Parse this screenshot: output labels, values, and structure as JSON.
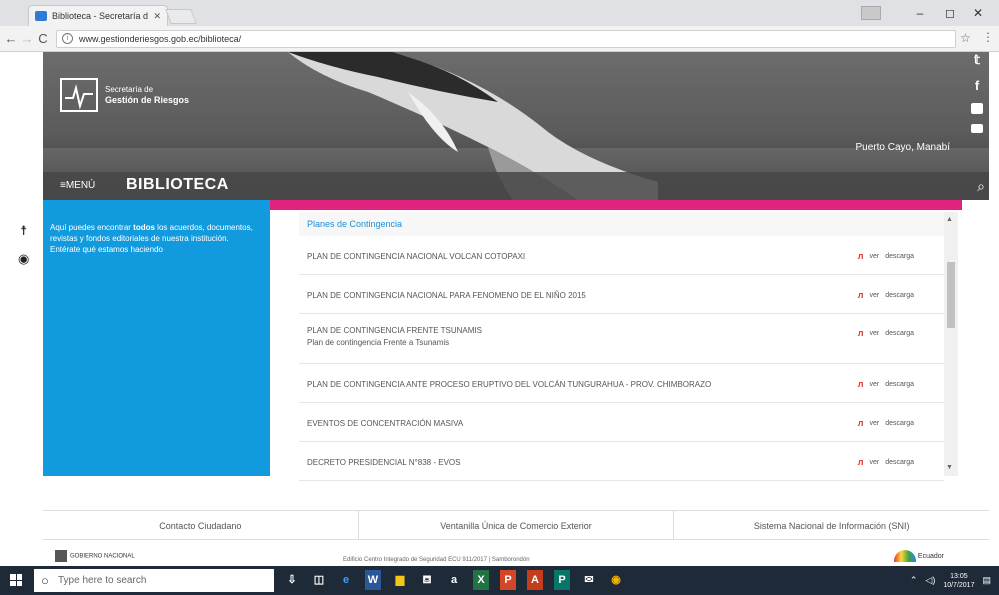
{
  "browser": {
    "tab_title": "Biblioteca - Secretaría de",
    "tab_close": "✕",
    "win_minimize": "–",
    "win_maximize": "◻",
    "win_close": "✕",
    "url": "www.gestionderiesgos.gob.ec/biblioteca/",
    "back": "←",
    "forward": "→",
    "reload": "C",
    "info": "i",
    "star": "☆",
    "menu": "⋮"
  },
  "header": {
    "logo_line1": "Secretaría de",
    "logo_line2": "Gestión de Riesgos",
    "location": "Puerto Cayo, Manabí",
    "menu_toggle": "≡MENÚ",
    "page_title": "BIBLIOTECA",
    "social": {
      "twitter": "𝕥",
      "facebook": "f"
    },
    "search": "⌕"
  },
  "accessibility": {
    "person": "☨",
    "eye": "◉"
  },
  "sidebar": {
    "intro_pre": "Aquí puedes encontrar ",
    "intro_bold": "todos",
    "intro_post": " los acuerdos, documentos, revistas y fondos editoriales de nuestra institución.",
    "cta": "Entérate qué estamos haciendo"
  },
  "documents": {
    "category": "Planes de Contingencia",
    "view_label": "ver",
    "download_label": "descarga",
    "items": [
      {
        "title": "PLAN DE CONTINGENCIA NACIONAL VOLCAN COTOPAXI",
        "subtitle": ""
      },
      {
        "title": "PLAN DE CONTINGENCIA NACIONAL PARA FENOMENO DE EL NIÑO 2015",
        "subtitle": ""
      },
      {
        "title": "PLAN DE CONTINGENCIA FRENTE TSUNAMIS",
        "subtitle": "Plan de contingencia Frente a Tsunamis"
      },
      {
        "title": "PLAN DE CONTINGENCIA ANTE PROCESO ERUPTIVO DEL VOLCÁN TUNGURAHUA - PROV. CHIMBORAZO",
        "subtitle": ""
      },
      {
        "title": "EVENTOS DE CONCENTRACIÓN MASIVA",
        "subtitle": ""
      },
      {
        "title": "DECRETO PRESIDENCIAL N°838 - EVOS",
        "subtitle": ""
      }
    ]
  },
  "footer": {
    "links": [
      "Contacto Ciudadano",
      "Ventanilla Única de Comercio Exterior",
      "Sistema Nacional de Información (SNI)"
    ],
    "logo_text": "GOBIERNO NACIONAL",
    "address": "Edificio Centro Integrado de Seguridad ECU 911/2017 | Samborondón",
    "badge": "Ecuador"
  },
  "taskbar": {
    "search_placeholder": "Type here to search",
    "mic": "⇩",
    "time": "13:05",
    "date": "10/7/2017"
  }
}
